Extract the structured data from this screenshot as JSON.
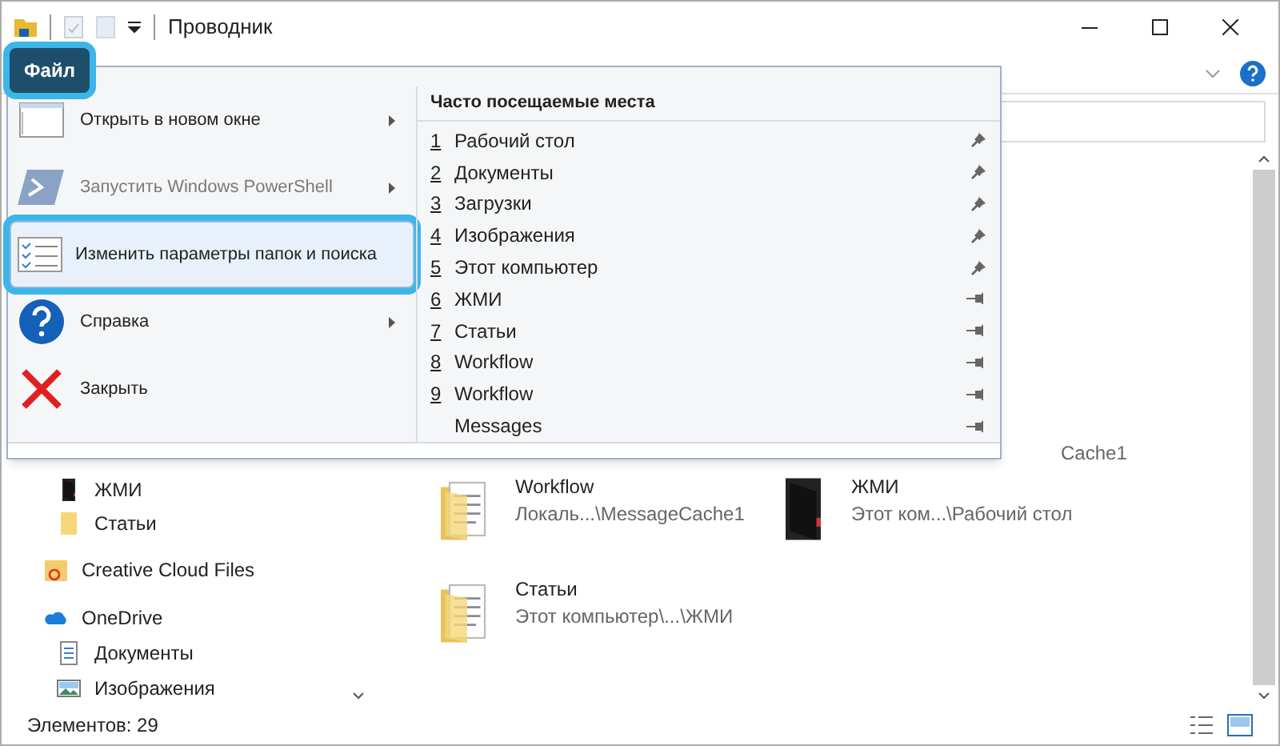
{
  "window": {
    "title": "Проводник"
  },
  "file_tab": {
    "label": "Файл",
    "selected": true
  },
  "file_menu": {
    "commands": [
      {
        "label": "Открыть в новом окне",
        "kind": "window",
        "submenu": true,
        "disabled": false,
        "selected": false
      },
      {
        "label": "Запустить Windows PowerShell",
        "kind": "powershell",
        "submenu": true,
        "disabled": true,
        "selected": false
      },
      {
        "label": "Изменить параметры папок и поиска",
        "kind": "options",
        "submenu": false,
        "disabled": false,
        "selected": true
      },
      {
        "label": "Справка",
        "kind": "help",
        "submenu": true,
        "disabled": false,
        "selected": false
      },
      {
        "label": "Закрыть",
        "kind": "close",
        "submenu": false,
        "disabled": false,
        "selected": false
      }
    ],
    "frequent": {
      "title": "Часто посещаемые места",
      "items": [
        {
          "number": "1",
          "label": "Рабочий стол",
          "pinned": true
        },
        {
          "number": "2",
          "label": "Документы",
          "pinned": true
        },
        {
          "number": "3",
          "label": "Загрузки",
          "pinned": true
        },
        {
          "number": "4",
          "label": "Изображения",
          "pinned": true
        },
        {
          "number": "5",
          "label": "Этот компьютер",
          "pinned": true
        },
        {
          "number": "6",
          "label": "ЖМИ",
          "pinned": false
        },
        {
          "number": "7",
          "label": "Статьи",
          "pinned": false
        },
        {
          "number": "8",
          "label": "Workflow",
          "pinned": false
        },
        {
          "number": "9",
          "label": "Workflow",
          "pinned": false
        },
        {
          "label": "Messages",
          "pinned": false
        }
      ]
    }
  },
  "navigation": {
    "partial_children": [
      {
        "label": "ЖМИ",
        "kind": "dark-folder"
      },
      {
        "label": "Статьи",
        "kind": "folder"
      }
    ],
    "items": [
      {
        "label": "Creative Cloud Files",
        "kind": "cloud-folder"
      },
      {
        "label": "OneDrive",
        "kind": "onedrive",
        "children": [
          {
            "label": "Документы",
            "kind": "documents"
          },
          {
            "label": "Изображения",
            "kind": "pictures"
          }
        ]
      }
    ]
  },
  "content": {
    "partial_text": "Cache1",
    "tiles": [
      {
        "name": "Workflow",
        "path": "Локаль...\\MessageCache1",
        "kind": "doc-folder"
      },
      {
        "name": "ЖМИ",
        "path": "Этот ком...\\Рабочий стол",
        "kind": "dark-folder"
      },
      {
        "name": "Статьи",
        "path": "Этот компьютер\\...\\ЖМИ",
        "kind": "doc-folder"
      }
    ]
  },
  "status_bar": {
    "count": "Элементов: 29"
  }
}
